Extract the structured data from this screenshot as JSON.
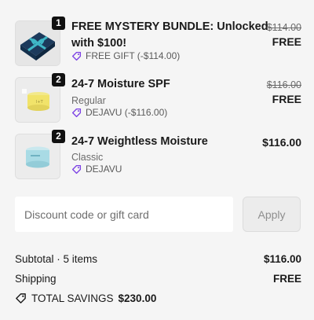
{
  "items": [
    {
      "quantity": "1",
      "title_line1": "FREE MYSTERY BUNDLE: Unlocked",
      "title_line2": "with $100!",
      "discount": "FREE GIFT (-$114.00)",
      "original_price": "$114.00",
      "price": "FREE",
      "image_icon": "gift-box-icon"
    },
    {
      "quantity": "2",
      "title": "24-7 Moisture SPF",
      "variant": "Regular",
      "discount": "DEJAVU (-$116.00)",
      "original_price": "$116.00",
      "price": "FREE",
      "image_icon": "yellow-cream-jar-icon"
    },
    {
      "quantity": "2",
      "title": "24-7 Weightless Moisture",
      "variant": "Classic",
      "discount": "DEJAVU",
      "price": "$116.00",
      "image_icon": "blue-cream-jar-icon"
    }
  ],
  "discount_form": {
    "placeholder": "Discount code or gift card",
    "apply_label": "Apply"
  },
  "summary": {
    "subtotal_label": "Subtotal · 5 items",
    "subtotal_value": "$116.00",
    "shipping_label": "Shipping",
    "shipping_value": "FREE",
    "savings_label": "TOTAL SAVINGS",
    "savings_value": "$230.00"
  },
  "colors": {
    "tag_icon": "#7b3fe4",
    "background": "#f5f5f5",
    "badge": "#111111"
  }
}
